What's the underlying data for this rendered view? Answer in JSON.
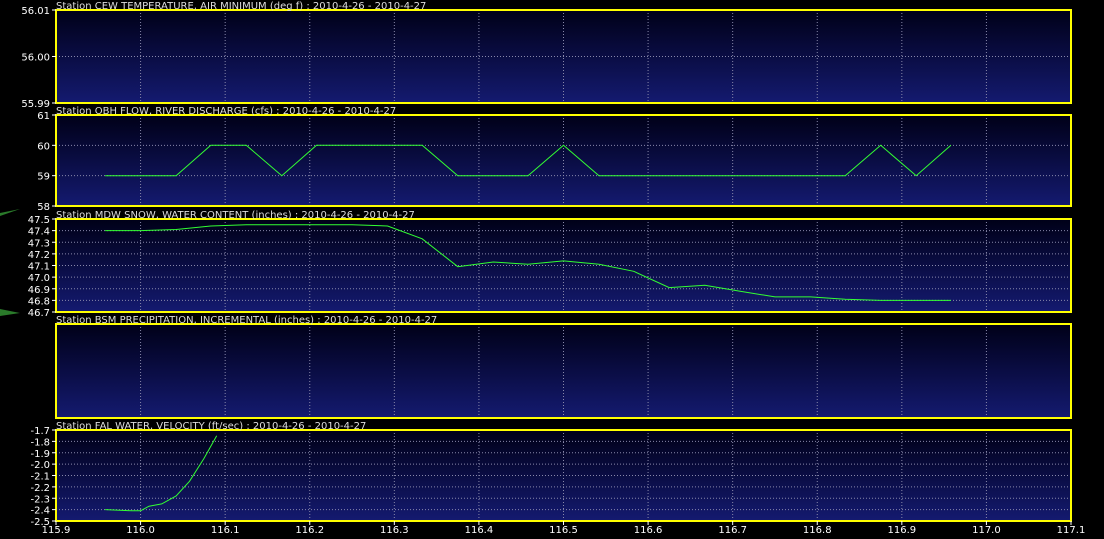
{
  "colors": {
    "background": "#000000",
    "panel_top": "#000018",
    "panel_bottom": "#141a70",
    "frame": "#ffff00",
    "grid": "#8888aa",
    "title_text": "#dddddd",
    "tick_text": "#ffffff",
    "line": "#33ff33",
    "marker": "#2a7a2a"
  },
  "x_axis": {
    "min": 115.9,
    "max": 117.1,
    "ticks": [
      115.9,
      116.0,
      116.1,
      116.2,
      116.3,
      116.4,
      116.5,
      116.6,
      116.7,
      116.8,
      116.9,
      117.0,
      117.1
    ],
    "tick_labels": [
      "115.9",
      "116.0",
      "116.1",
      "116.2",
      "116.3",
      "116.4",
      "116.5",
      "116.6",
      "116.7",
      "116.8",
      "116.9",
      "117.0",
      "117.1"
    ]
  },
  "chart_data": [
    {
      "type": "line",
      "title": "Station CEW TEMPERATURE, AIR MINIMUM (deg f) : 2010-4-26 - 2010-4-27",
      "ylim": [
        55.99,
        56.01
      ],
      "yticks": [
        55.99,
        56.0,
        56.01
      ],
      "ytick_labels": [
        "55.99",
        "56.00",
        "56.01"
      ],
      "x": [],
      "y": []
    },
    {
      "type": "line",
      "title": "Station OBH FLOW, RIVER DISCHARGE (cfs) : 2010-4-26 - 2010-4-27",
      "ylim": [
        58,
        61
      ],
      "yticks": [
        58,
        59,
        60,
        61
      ],
      "ytick_labels": [
        "58",
        "59",
        "60",
        "61"
      ],
      "x": [
        115.958,
        116.042,
        116.083,
        116.125,
        116.167,
        116.208,
        116.25,
        116.292,
        116.333,
        116.375,
        116.417,
        116.458,
        116.5,
        116.542,
        116.583,
        116.625,
        116.667,
        116.708,
        116.75,
        116.792,
        116.833,
        116.875,
        116.917,
        116.958
      ],
      "y": [
        59,
        59,
        60,
        60,
        59,
        60,
        60,
        60,
        60,
        59,
        59,
        59,
        60,
        59,
        59,
        59,
        59,
        59,
        59,
        59,
        59,
        60,
        59,
        60
      ]
    },
    {
      "type": "line",
      "title": "Station MDW SNOW, WATER CONTENT (inches) : 2010-4-26 - 2010-4-27",
      "ylim": [
        46.7,
        47.5
      ],
      "yticks": [
        46.7,
        46.8,
        46.9,
        47.0,
        47.1,
        47.2,
        47.3,
        47.4,
        47.5
      ],
      "ytick_labels": [
        "46.7",
        "46.8",
        "46.9",
        "47.0",
        "47.1",
        "47.2",
        "47.3",
        "47.4",
        "47.5"
      ],
      "x": [
        115.958,
        116.0,
        116.042,
        116.083,
        116.125,
        116.167,
        116.208,
        116.25,
        116.292,
        116.333,
        116.375,
        116.417,
        116.458,
        116.5,
        116.542,
        116.583,
        116.625,
        116.667,
        116.708,
        116.75,
        116.792,
        116.833,
        116.875,
        116.917,
        116.958
      ],
      "y": [
        47.4,
        47.4,
        47.41,
        47.44,
        47.45,
        47.45,
        47.45,
        47.45,
        47.44,
        47.33,
        47.09,
        47.13,
        47.11,
        47.14,
        47.11,
        47.05,
        46.91,
        46.93,
        46.88,
        46.83,
        46.83,
        46.81,
        46.8,
        46.8,
        46.8
      ]
    },
    {
      "type": "line",
      "title": "Station BSM PRECIPITATION, INCREMENTAL (inches) : 2010-4-26 - 2010-4-27",
      "ylim": [
        0,
        1
      ],
      "yticks": [],
      "ytick_labels": [],
      "x": [],
      "y": []
    },
    {
      "type": "line",
      "title": "Station FAL WATER, VELOCITY (ft/sec) : 2010-4-26 - 2010-4-27",
      "ylim": [
        -2.5,
        -1.7
      ],
      "yticks": [
        -2.5,
        -2.4,
        -2.3,
        -2.2,
        -2.1,
        -2.0,
        -1.9,
        -1.8,
        -1.7
      ],
      "ytick_labels": [
        "-2.5",
        "-2.4",
        "-2.3",
        "-2.2",
        "-2.1",
        "-2.0",
        "-1.9",
        "-1.8",
        "-1.7"
      ],
      "x": [
        115.958,
        115.99,
        116.0,
        116.01,
        116.025,
        116.042,
        116.058,
        116.075,
        116.09
      ],
      "y": [
        -2.4,
        -2.41,
        -2.41,
        -2.37,
        -2.35,
        -2.28,
        -2.15,
        -1.95,
        -1.75
      ]
    }
  ]
}
